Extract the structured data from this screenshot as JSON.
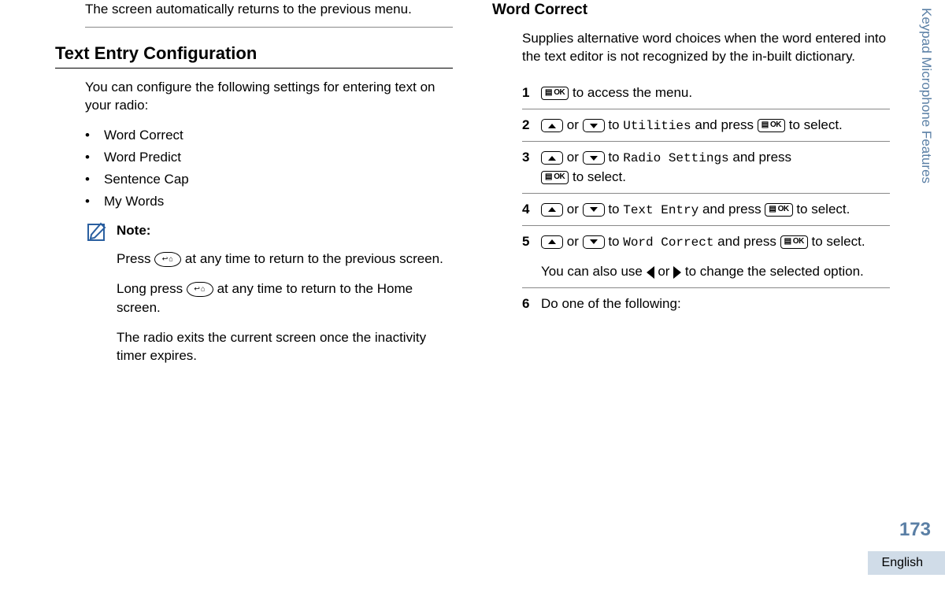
{
  "sideTab": "Keypad Microphone Features",
  "pageNum": "173",
  "lang": "English",
  "left": {
    "topPara": "The screen automatically returns to the previous menu.",
    "sectionTitle": "Text Entry Configuration",
    "intro": "You can configure the following settings for entering text on your radio:",
    "bullets": [
      "Word Correct",
      "Word Predict",
      "Sentence Cap",
      "My Words"
    ],
    "noteLabel": "Note:",
    "noteP1a": "Press ",
    "noteP1b": " at any time to return to the previous screen.",
    "noteP2a": "Long press ",
    "noteP2b": " at any time to return to the Home screen.",
    "noteP3": "The radio exits the current screen once the inactivity timer expires."
  },
  "right": {
    "subTitle": "Word Correct",
    "intro": "Supplies alternative word choices when the word entered into the text editor is not recognized by the in-built dictionary.",
    "step1": " to access the menu.",
    "orWord": " or ",
    "toWord": " to ",
    "andPress": " and press ",
    "toSelect": " to select.",
    "util": "Utilities",
    "radioSettings": "Radio Settings",
    "textEntry": "Text Entry",
    "wordCorrect": "Word Correct",
    "step5tail": "You can also use ",
    "step5tail2": " to change the selected option.",
    "step6": "Do one of the following:",
    "okLabel": "▤ OK"
  }
}
